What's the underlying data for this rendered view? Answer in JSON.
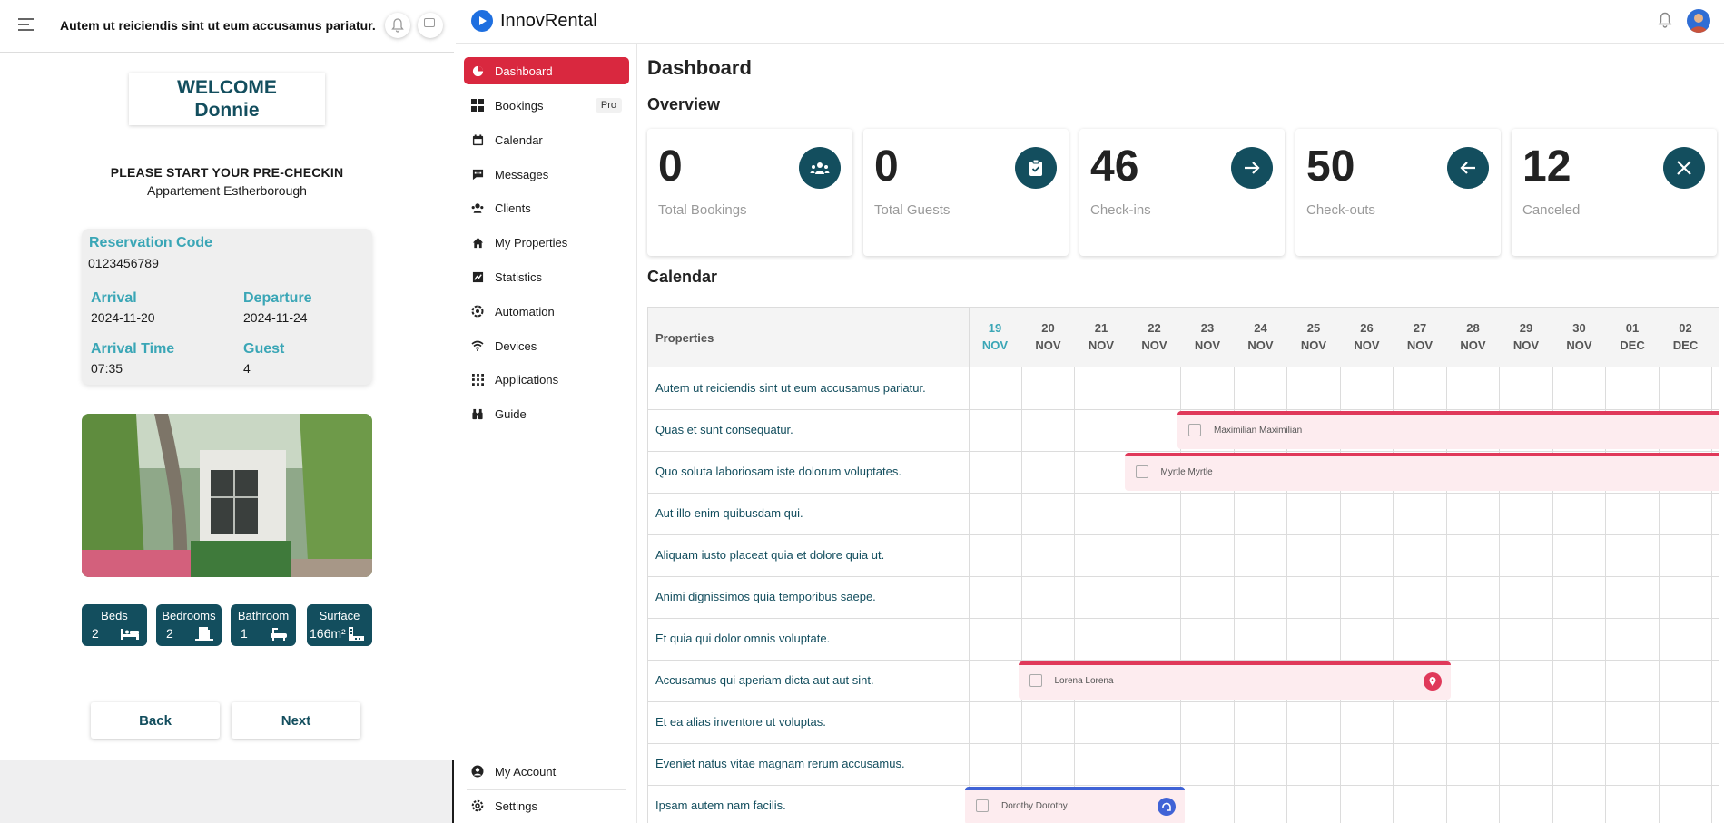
{
  "left": {
    "header_title": "Autem ut reiciendis sint ut eum accusamus pariatur.",
    "welcome_line1": "WELCOME",
    "welcome_line2": "Donnie",
    "precheck_title": "PLEASE START YOUR PRE-CHECKIN",
    "apartment": "Appartement Estherborough",
    "reservation": {
      "code_label": "Reservation Code",
      "code": "0123456789",
      "arrival_label": "Arrival",
      "arrival": "2024-11-20",
      "departure_label": "Departure",
      "departure": "2024-11-24",
      "arrival_time_label": "Arrival Time",
      "arrival_time": "07:35",
      "guest_label": "Guest",
      "guest": "4"
    },
    "stats": [
      {
        "label": "Beds",
        "value": "2",
        "icon": "bed-icon"
      },
      {
        "label": "Bedrooms",
        "value": "2",
        "icon": "door-icon"
      },
      {
        "label": "Bathroom",
        "value": "1",
        "icon": "bathtub-icon"
      },
      {
        "label": "Surface",
        "value": "166m²",
        "icon": "ruler-icon"
      }
    ],
    "back_label": "Back",
    "next_label": "Next"
  },
  "app": {
    "brand": "InnovRental",
    "accent_color": "#d9283f",
    "teal_color": "#134e5e",
    "nav": [
      {
        "label": "Dashboard",
        "icon": "pie-chart-icon",
        "active": true
      },
      {
        "label": "Bookings",
        "icon": "grid-icon",
        "badge": "Pro"
      },
      {
        "label": "Calendar",
        "icon": "calendar-icon"
      },
      {
        "label": "Messages",
        "icon": "chat-icon"
      },
      {
        "label": "Clients",
        "icon": "users-icon"
      },
      {
        "label": "My Properties",
        "icon": "home-icon"
      },
      {
        "label": "Statistics",
        "icon": "chart-icon"
      },
      {
        "label": "Automation",
        "icon": "gear-icon"
      },
      {
        "label": "Devices",
        "icon": "wifi-icon"
      },
      {
        "label": "Applications",
        "icon": "apps-icon"
      },
      {
        "label": "Guide",
        "icon": "binoculars-icon"
      }
    ],
    "nav_bottom": [
      {
        "label": "My Account",
        "icon": "account-icon"
      },
      {
        "label": "Settings",
        "icon": "settings-icon"
      }
    ],
    "page_title": "Dashboard",
    "overview_title": "Overview",
    "cards": [
      {
        "value": "0",
        "label": "Total Bookings",
        "icon": "group-icon"
      },
      {
        "value": "0",
        "label": "Total Guests",
        "icon": "clipboard-icon"
      },
      {
        "value": "46",
        "label": "Check-ins",
        "icon": "arrow-right-icon"
      },
      {
        "value": "50",
        "label": "Check-outs",
        "icon": "arrow-left-icon"
      },
      {
        "value": "12",
        "label": "Canceled",
        "icon": "close-icon"
      }
    ],
    "calendar_title": "Calendar",
    "properties_header": "Properties",
    "days": [
      {
        "day": "19",
        "month": "NOV",
        "today": true
      },
      {
        "day": "20",
        "month": "NOV"
      },
      {
        "day": "21",
        "month": "NOV"
      },
      {
        "day": "22",
        "month": "NOV"
      },
      {
        "day": "23",
        "month": "NOV"
      },
      {
        "day": "24",
        "month": "NOV"
      },
      {
        "day": "25",
        "month": "NOV"
      },
      {
        "day": "26",
        "month": "NOV"
      },
      {
        "day": "27",
        "month": "NOV"
      },
      {
        "day": "28",
        "month": "NOV"
      },
      {
        "day": "29",
        "month": "NOV"
      },
      {
        "day": "30",
        "month": "NOV"
      },
      {
        "day": "01",
        "month": "DEC"
      },
      {
        "day": "02",
        "month": "DEC"
      }
    ],
    "properties": [
      "Autem ut reiciendis sint ut eum accusamus pariatur.",
      "Quas et sunt consequatur.",
      "Quo soluta laboriosam iste dolorum voluptates.",
      "Aut illo enim quibusdam qui.",
      "Aliquam iusto placeat quia et dolore quia ut.",
      "Animi dignissimos quia temporibus saepe.",
      "Et quia qui dolor omnis voluptate.",
      "Accusamus qui aperiam dicta aut aut sint.",
      "Et ea alias inventore ut voluptas.",
      "Eveniet natus vitae magnam rerum accusamus.",
      "Ipsam autem nam facilis."
    ],
    "bookings": [
      {
        "guest": "Maximilian Maximilian",
        "row": 1,
        "start_day": "23",
        "end_day": "02+",
        "color": "#e0395a"
      },
      {
        "guest": "Myrtle Myrtle",
        "row": 2,
        "start_day": "22",
        "end_day": "02+",
        "color": "#e0395a"
      },
      {
        "guest": "Lorena Lorena",
        "row": 7,
        "start_day": "20",
        "end_day": "28",
        "color": "#e0395a",
        "icon": "pin-icon"
      },
      {
        "guest": "Dorothy Dorothy",
        "row": 10,
        "start_day": "19",
        "end_day": "23",
        "color": "#4063d6",
        "icon": "airbnb-icon"
      }
    ]
  }
}
